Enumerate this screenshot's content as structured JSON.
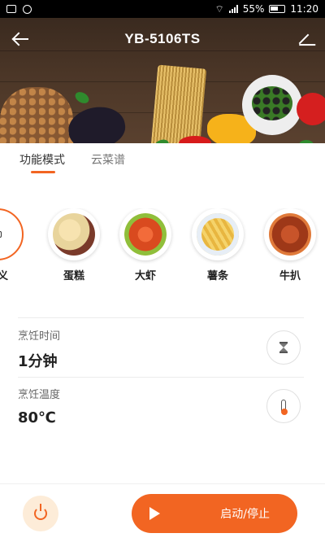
{
  "status_bar": {
    "battery": "55%",
    "time": "11:20"
  },
  "header": {
    "title": "YB-5106TS"
  },
  "tabs": [
    {
      "label": "功能模式",
      "active": true
    },
    {
      "label": "云菜谱",
      "active": false
    }
  ],
  "modes": [
    {
      "label": "定义",
      "icon": "custom-icon",
      "selected": true
    },
    {
      "label": "蛋糕",
      "icon": "cake-icon",
      "selected": false
    },
    {
      "label": "大虾",
      "icon": "shrimp-icon",
      "selected": false
    },
    {
      "label": "薯条",
      "icon": "fries-icon",
      "selected": false
    },
    {
      "label": "牛扒",
      "icon": "steak-icon",
      "selected": false
    }
  ],
  "settings": {
    "time": {
      "label": "烹饪时间",
      "value": "1分钟",
      "icon": "hourglass-icon"
    },
    "temperature": {
      "label": "烹饪温度",
      "value": "80℃",
      "icon": "thermometer-icon"
    }
  },
  "bottom": {
    "start_label": "启动/停止"
  },
  "colors": {
    "accent": "#f26522",
    "power_bg": "#fdecd8"
  }
}
